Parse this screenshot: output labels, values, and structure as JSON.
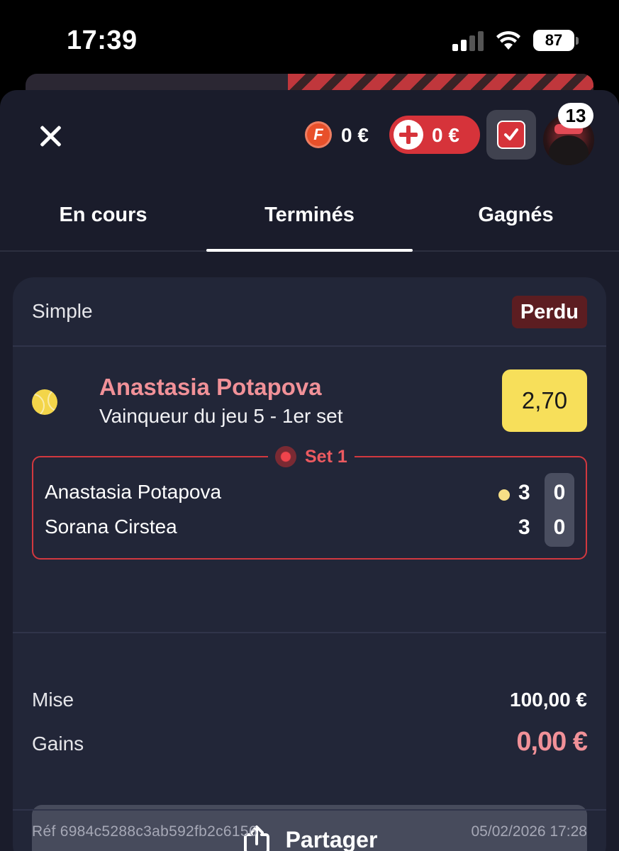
{
  "status_bar": {
    "time": "17:39",
    "battery": "87"
  },
  "header": {
    "coin_letter": "F",
    "coin_balance": "0 €",
    "bonus_balance": "0 €",
    "notifications_count": "13"
  },
  "tabs": [
    {
      "label": "En cours",
      "active": false
    },
    {
      "label": "Terminés",
      "active": true
    },
    {
      "label": "Gagnés",
      "active": false
    }
  ],
  "bet": {
    "type": "Simple",
    "status": "Perdu",
    "selection": "Anastasia Potapova",
    "market": "Vainqueur du jeu 5 - 1er set",
    "odds": "2,70",
    "score": {
      "set_label": "Set 1",
      "players": [
        {
          "name": "Anastasia Potapova",
          "games": "3",
          "points": "0",
          "serving": true
        },
        {
          "name": "Sorana Cirstea",
          "games": "3",
          "points": "0",
          "serving": false
        }
      ]
    },
    "stake_label": "Mise",
    "stake": "100,00 €",
    "gains_label": "Gains",
    "gains": "0,00 €",
    "share_label": "Partager",
    "reference": "Réf 6984c5288c3ab592fb2c6156",
    "date": "05/02/2026 17:28"
  },
  "colors": {
    "sheet_bg": "#1a1c2b",
    "card_bg": "#222638",
    "accent_red": "#d6333a",
    "pink": "#f19198",
    "odds_yellow": "#f7df5a"
  }
}
